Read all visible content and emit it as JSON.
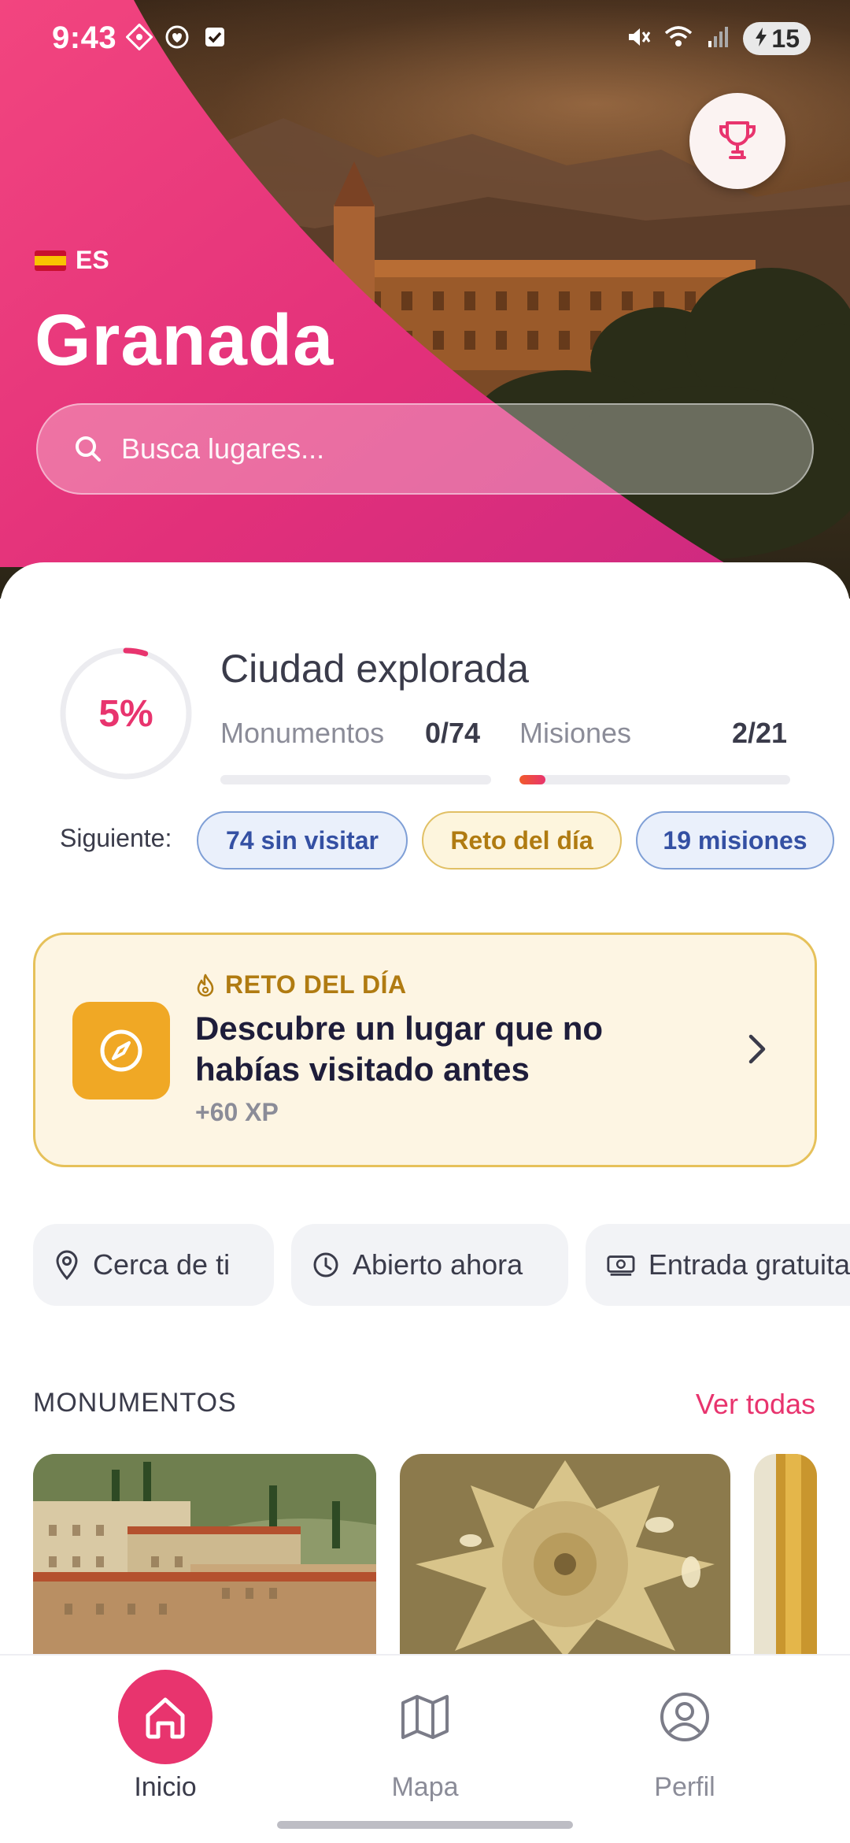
{
  "status_bar": {
    "time": "9:43",
    "battery": "15"
  },
  "hero": {
    "country_code": "ES",
    "city": "Granada",
    "trophy_icon": "trophy-icon"
  },
  "search": {
    "placeholder": "Busca lugares..."
  },
  "progress": {
    "percent_label": "5%",
    "percent_value": 5,
    "title": "Ciudad explorada",
    "monuments_label": "Monumentos",
    "monuments_value": "0/74",
    "monuments_fraction": 0,
    "missions_label": "Misiones",
    "missions_value": "2/21",
    "missions_fraction": 0.095
  },
  "next": {
    "label": "Siguiente:",
    "chips": [
      "74 sin visitar",
      "Reto del día",
      "19 misiones"
    ]
  },
  "challenge": {
    "kicker": "RETO DEL DÍA",
    "title": "Descubre un lugar que no habías visitado antes",
    "xp": "+60 XP"
  },
  "filters": [
    "Cerca de ti",
    "Abierto ahora",
    "Entrada gratuita"
  ],
  "monuments_section": {
    "title": "MONUMENTOS",
    "link": "Ver todas"
  },
  "nav": {
    "items": [
      "Inicio",
      "Mapa",
      "Perfil"
    ],
    "active": "Inicio"
  },
  "colors": {
    "accent": "#e8346e",
    "gold": "#f0a825",
    "chip_blue": "#3450a3"
  }
}
